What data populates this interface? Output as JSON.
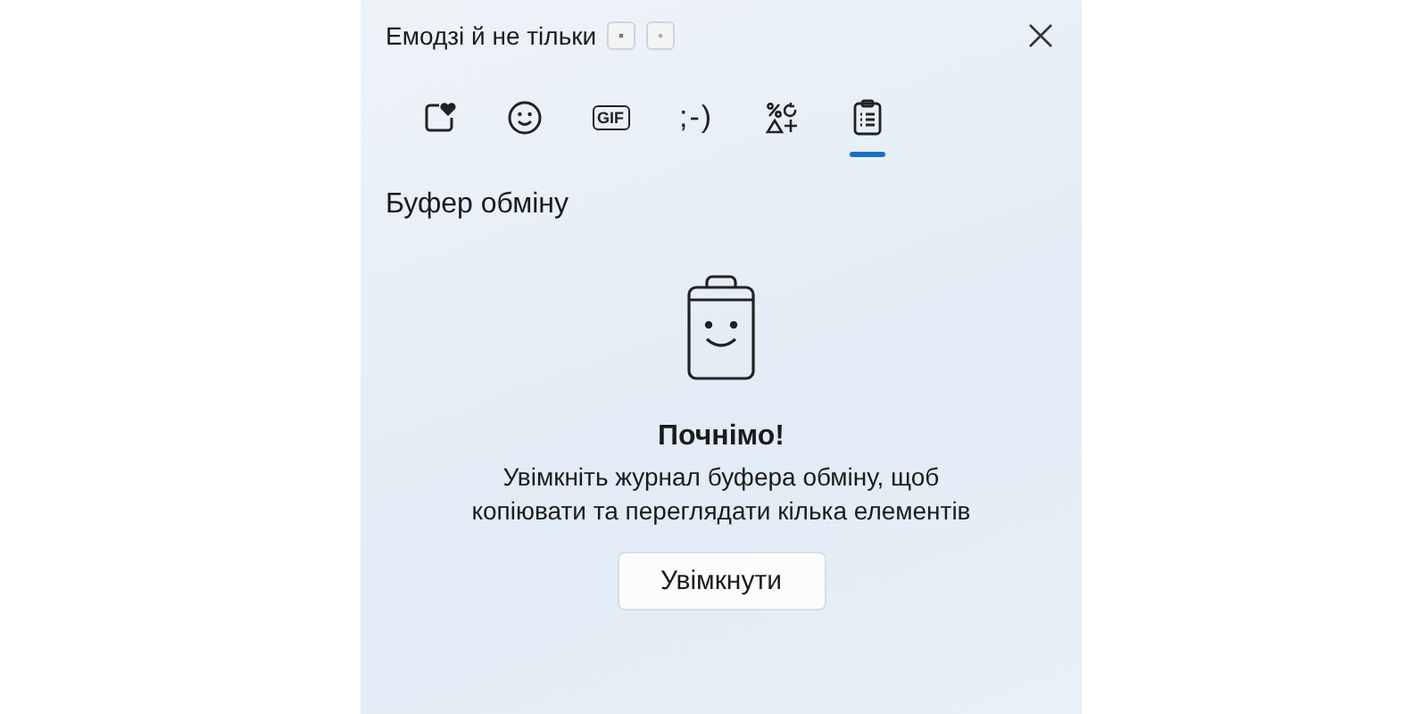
{
  "window": {
    "title": "Емодзі й не тільки"
  },
  "tabs": [
    {
      "kind": "favorites",
      "selected": false
    },
    {
      "kind": "emoji",
      "selected": false
    },
    {
      "kind": "gif",
      "label": "GIF",
      "selected": false
    },
    {
      "kind": "kaomoji",
      "label": ";-)",
      "selected": false
    },
    {
      "kind": "symbols",
      "selected": false
    },
    {
      "kind": "clipboard",
      "selected": true
    }
  ],
  "section": {
    "title": "Буфер обміну"
  },
  "empty_state": {
    "heading": "Почнімо!",
    "message": "Увімкніть журнал буфера обміну, щоб копіювати та переглядати кілька елементів",
    "button": "Увімкнути"
  }
}
